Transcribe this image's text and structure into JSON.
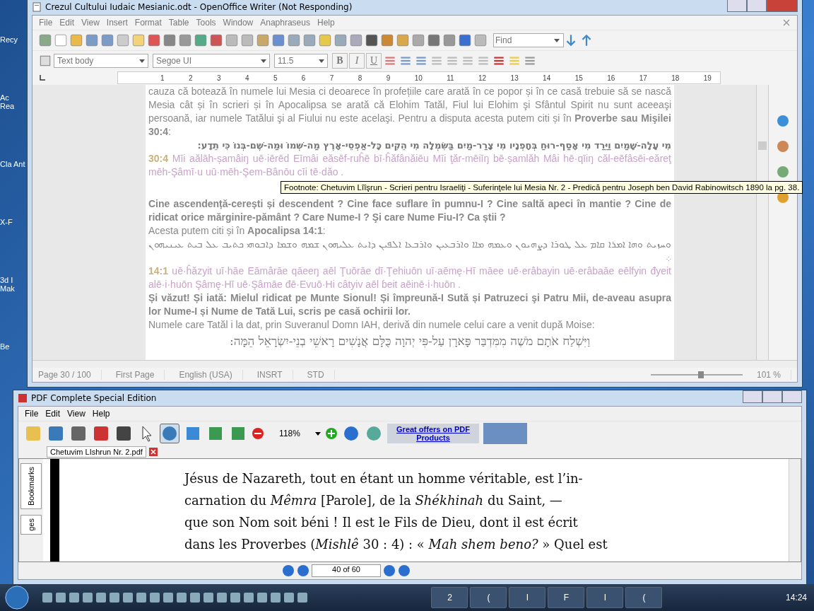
{
  "desktop_icons": [
    "Recy",
    "Ac Rea",
    "Cla Ant",
    "X-F",
    "3d I Mak",
    "Be"
  ],
  "writer": {
    "title": "Crezul Cultului Iudaic Mesianic.odt - OpenOffice Writer (Not Responding)",
    "menu": [
      "File",
      "Edit",
      "View",
      "Insert",
      "Format",
      "Table",
      "Tools",
      "Window",
      "Anaphraseus",
      "Help"
    ],
    "find": {
      "placeholder": "Find"
    },
    "style_box": "Text body",
    "font_box": "Segoe UI",
    "size_box": "11.5",
    "format_buttons": [
      {
        "label": "B",
        "kind": "bold"
      },
      {
        "label": "I",
        "kind": "italic"
      },
      {
        "label": "U",
        "kind": "underline"
      }
    ],
    "ruler": [
      "1",
      "2",
      "3",
      "4",
      "5",
      "6",
      "7",
      "8",
      "9",
      "10",
      "11",
      "12",
      "13",
      "14",
      "15",
      "16",
      "17",
      "18",
      "19"
    ],
    "document": [
      {
        "kind": "text",
        "text": "cauza că botează în numele lui Mesia ci deoarece în profețiile care arată în ce popor și în ce casă trebuie să se nască Mesia cât și în scrieri și în Apocalipsa se arată că Elohim Tatăl, Fiul lui Elohim şi Sfântul Spirit nu sunt aceeaşi persoană, iar numele Tatălui şi al Fiului nu este acelaşi. Pentru a disputa acesta putem citi și în **Proverbe sau Mişilei 30:4**:"
      },
      {
        "kind": "hebrew",
        "text": "מִי עָלָה-שָׁמַיִם וַיֵּרַד מִי אָסַף-רוּחַ בְּחָפְנָיו מִי צָרַר-מַיִם בַּשִּׂמְלָה מִי הֵקִים כָּל-אַפְסֵי-אָרֶץ מַה-שְּׁמוֹ וּמַה-שֶּׁם-בְּנוֹ כִּי תֵדָע:"
      },
      {
        "kind": "transliteration",
        "ref": "30:4",
        "text": "Mīi aălāh-șamâiŋ uē·iērēd Eīmâi eăsēf-ruĥē bī·ĥăfânăiēu Mīi ţăr-mēiīŋ bē·șamlăh Mâi hē·qīiŋ căl-eēfâsēi-eăreţ mēh-Şâmī·u uū·mēh-Şem-Bânōu cīi tē·dăo ."
      },
      {
        "kind": "bold",
        "text": "Cine ascendență-cerești și descendent ? Cine face suflare în pumnu-I ? Cine saltă apeci în mantie ? Cine de ridicat orice mărginire-pământ ? Care Nume-I ? Şi care Nume Fiu-I? Ca știi ?"
      },
      {
        "kind": "text",
        "text": "Acesta putem citi și în **Apocalipsa 14:1**:"
      },
      {
        "kind": "syriac",
        "text": "ܘܚܙܝܬ ܘܗܐ ܐܡܪܐ ܩܐܡ ܥܠ ܛܘܪܐ ܕܨܗܝܘܢ ܘܥܡܗ ܡܐܐ ܘܐܪܒܥܝܢ ܘܐܪܒܥܐ ܐܠܦܝܢ ܕܐܝܬ ܥܠܝܗܘܢ ܫܡܗ ܘܫܡܐ ܕܐܒܘܗܝ ܟܬܝܒ ܥܠ ܒܝܬ ܥܝܢܝܗܘܢ ܀"
      },
      {
        "kind": "transliteration",
        "ref": "14:1",
        "text": "uē·ĥăzyit uī·hāe Eāmârāe qāeeŋ aēl Ţuōrāe dī·Ţehiuōn uī·aēmę·Hī māee uē·erâbayin uē·erâbaāe eēlfyin đyeit alē·i·huōn Şâmę·Hī uē·Şâmāe đē·Evuō·Hi câtyiv aēl ɓeit aēinē·i·huōn ."
      },
      {
        "kind": "bold",
        "text": "Și văzut! Și iată: Mielul ridicat pe Munte Sionul! Și împreună-I Sută și Patruzeci şi Patru Mii, de-aveau asupra lor Nume-I  și Nume de Tată Lui, scris pe casă ochirii lor."
      },
      {
        "kind": "text",
        "text": "Numele care Tatăl i la dat, prin Suveranul Domn IAH, derivă din numele celui care a venit după Moise:"
      },
      {
        "kind": "hebrew_large",
        "text": "וַיִּשְׁלַח אֹתָם מֹשֶׁה מִמִּדְבַּר פָּארָן עַל-פִּי יְהוָה כֻּלָּם אֲנָשִׁים רָאשֵׁי בְנֵי-יִשְׂרָאֵל הֵמָּה:"
      }
    ],
    "tooltip": "Footnote:  Chetuvim Lîîşrun - Scrieri pentru Israeliţi - Suferinţele lui Mesia Nr. 2 - Predică pentru Joseph ben David Rabinowitsch 1890 la pg. 38.",
    "status_bar": [
      "Page 30 / 100",
      "First Page",
      "English (USA)",
      "INSRT",
      "STD"
    ],
    "zoom": "101 %",
    "zoom_slider": {
      "level": 0.55
    }
  },
  "pdf": {
    "title": "PDF Complete Special Edition",
    "menu": [
      "File",
      "Edit",
      "View",
      "Help"
    ],
    "zoom": "118%",
    "ad": "Great offers on PDF Products",
    "tab": "Chetuvim LIshrun Nr. 2.pdf",
    "side_tabs": [
      "Bookmarks",
      "ges"
    ],
    "page_lines": [
      "Jésus de Nazareth, tout en étant un homme véritable, est l’in-",
      "carnation du *Mêmra* [Parole], de la *Shékhinah* du Saint, —",
      "que son Nom soit béni ! Il est le Fils de Dieu, dont il est écrit",
      "dans les Proverbes (*Mishlê* 30 : 4) : « *Mah shem beno?* » Quel est"
    ],
    "page_indicator": "40 of 60"
  },
  "taskbar": {
    "tasks": [
      "2",
      "(",
      "I",
      "F",
      "I",
      "("
    ],
    "clock": "14:24"
  }
}
